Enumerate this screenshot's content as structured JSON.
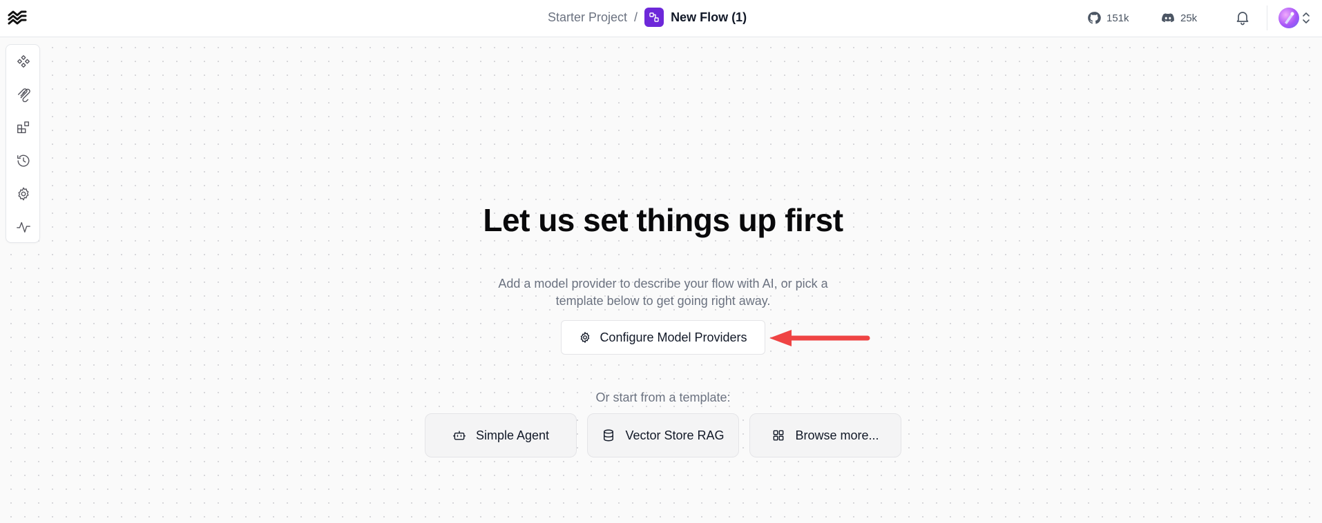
{
  "header": {
    "logo_icon": "langflow-logo-icon",
    "breadcrumb": {
      "project": "Starter Project",
      "separator": "/",
      "flow_name": "New Flow (1)",
      "flow_icon": "flow-nodes-icon",
      "flow_icon_color": "#6d28d9"
    },
    "github": {
      "icon": "github-icon",
      "count": "151k"
    },
    "discord": {
      "icon": "discord-icon",
      "count": "25k"
    },
    "notifications_icon": "bell-icon",
    "account_chevron_icon": "chevrons-up-down-icon"
  },
  "sidebar": {
    "items": [
      {
        "name": "components",
        "icon": "components-icon"
      },
      {
        "name": "mcp",
        "icon": "mcp-icon"
      },
      {
        "name": "bundles",
        "icon": "bundles-icon"
      },
      {
        "name": "history",
        "icon": "history-icon"
      },
      {
        "name": "settings",
        "icon": "gear-icon"
      },
      {
        "name": "traces",
        "icon": "activity-icon"
      }
    ]
  },
  "main": {
    "title": "Let us set things up first",
    "subtitle": "Add a model provider to describe your flow with AI, or pick a template below to get going right away.",
    "configure_button": {
      "label": "Configure Model Providers",
      "icon": "gear-icon"
    },
    "annotation_arrow_color": "#ef4444",
    "templates_label": "Or start from a template:",
    "templates": [
      {
        "label": "Simple Agent",
        "icon": "bot-icon"
      },
      {
        "label": "Vector Store RAG",
        "icon": "database-icon"
      },
      {
        "label": "Browse more...",
        "icon": "grid-icon"
      }
    ]
  }
}
